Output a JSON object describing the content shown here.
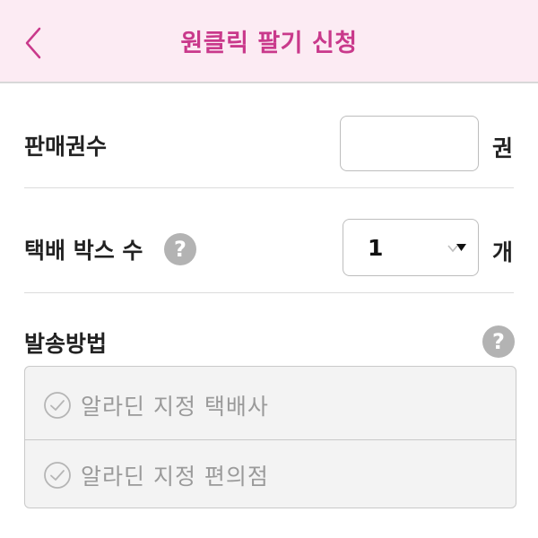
{
  "header": {
    "title": "원클릭 팔기 신청",
    "back_icon": "chevron-left-icon"
  },
  "colors": {
    "header_bg": "#fcebf3",
    "accent": "#c9398b",
    "help_icon_bg": "#b3b3b3"
  },
  "sale_count": {
    "label": "판매권수",
    "value": "",
    "unit": "권"
  },
  "box_count": {
    "label": "택배 박스 수",
    "help_icon": "question-icon",
    "selected": "1",
    "unit": "개"
  },
  "shipping": {
    "label": "발송방법",
    "help_icon": "question-icon",
    "options": [
      {
        "label": "알라딘 지정 택배사",
        "icon": "check-circle-icon",
        "selected": false
      },
      {
        "label": "알라딘 지정 편의점",
        "icon": "check-circle-icon",
        "selected": false
      }
    ]
  }
}
